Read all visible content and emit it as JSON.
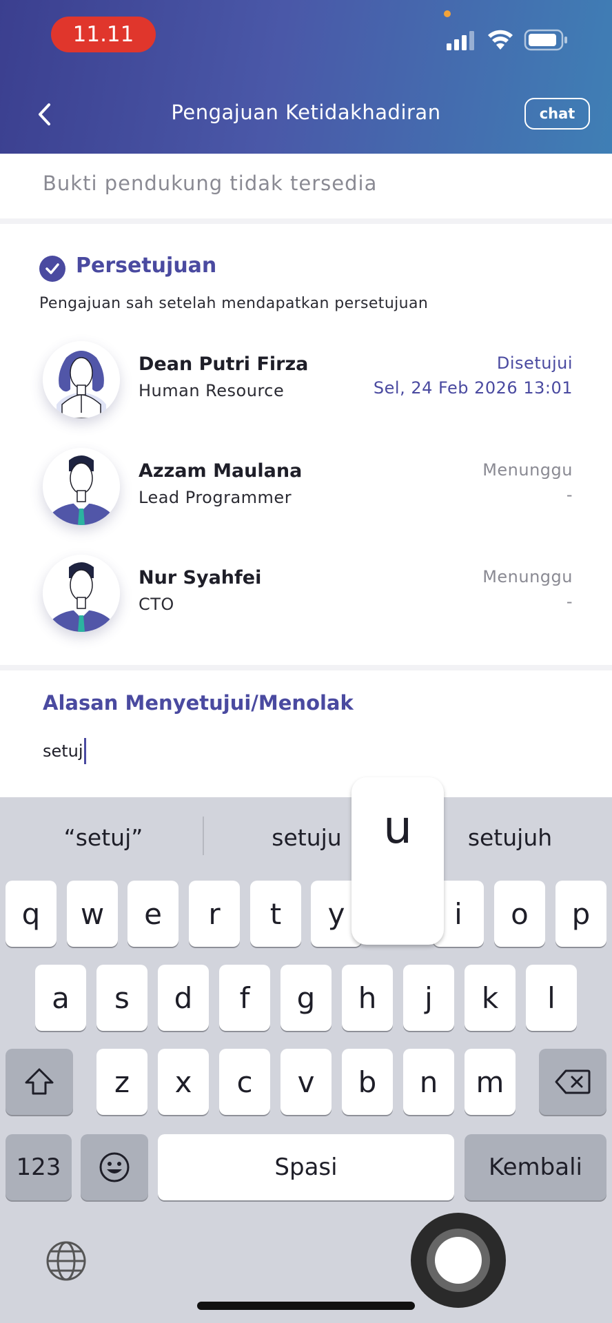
{
  "status_bar": {
    "time": "11.11"
  },
  "header": {
    "title": "Pengajuan Ketidakhadiran",
    "chat_label": "chat"
  },
  "support": {
    "text": "Bukti pendukung tidak tersedia"
  },
  "approval": {
    "title": "Persetujuan",
    "subtitle": "Pengajuan sah setelah mendapatkan persetujuan",
    "approvers": [
      {
        "name": "Dean Putri Firza",
        "role": "Human Resource",
        "status": "Disetujui",
        "date": "Sel, 24 Feb 2026 13:01"
      },
      {
        "name": "Azzam Maulana",
        "role": "Lead Programmer",
        "status": "Menunggu",
        "date": "-"
      },
      {
        "name": "Nur Syahfei",
        "role": "CTO",
        "status": "Menunggu",
        "date": "-"
      }
    ]
  },
  "reason": {
    "title": "Alasan Menyetujui/Menolak",
    "value": "setuj"
  },
  "keyboard": {
    "suggestions": [
      "“setuj”",
      "setuju",
      "setujuh"
    ],
    "popup_key": "u",
    "row1": [
      "q",
      "w",
      "e",
      "r",
      "t",
      "y",
      "",
      "i",
      "o",
      "p"
    ],
    "row2": [
      "a",
      "s",
      "d",
      "f",
      "g",
      "h",
      "j",
      "k",
      "l"
    ],
    "row3": [
      "z",
      "x",
      "c",
      "v",
      "b",
      "n",
      "m"
    ],
    "numbers_label": "123",
    "space_label": "Spasi",
    "return_label": "Kembali"
  },
  "colors": {
    "accent": "#4a4aa0",
    "header_start": "#3b3f8f",
    "header_end": "#3f7fb5",
    "time_pill": "#e0362c"
  }
}
